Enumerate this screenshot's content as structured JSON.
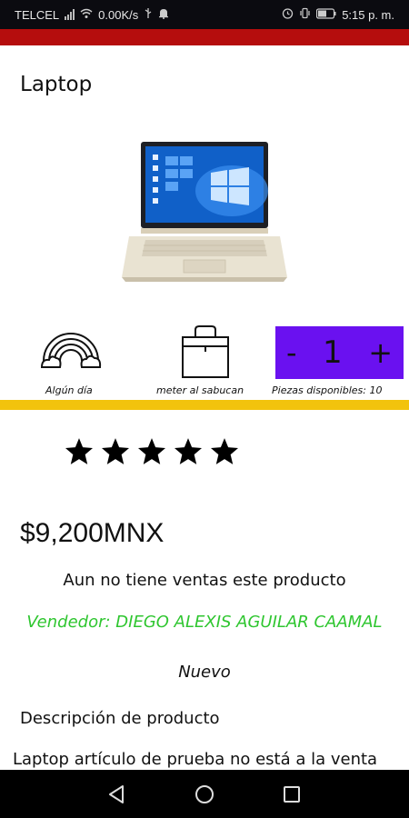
{
  "status_bar": {
    "carrier": "TELCEL",
    "speed": "0.00K/s",
    "time": "5:15 p. m.",
    "icons": [
      "signal-icon",
      "wifi-icon",
      "usb-icon",
      "notification-bell-icon",
      "alarm-icon",
      "vibrate-icon",
      "battery-icon"
    ]
  },
  "colors": {
    "header_accent": "#b50d0d",
    "quantity_bg": "#6a11f0",
    "divider": "#f2c30d",
    "seller_text": "#2fc630"
  },
  "product": {
    "title": "Laptop",
    "image": "laptop-photo",
    "features": [
      {
        "icon": "rainbow-icon",
        "caption": "Algún día"
      },
      {
        "icon": "shopping-bag-icon",
        "caption": "meter al sabucan"
      }
    ],
    "quantity": {
      "decrement_label": "-",
      "value": "1",
      "increment_label": "+",
      "available_caption": "Piezas disponibles: 10"
    },
    "rating_stars": 5,
    "price": "$9,200MNX",
    "sales_note": "Aun no tiene ventas este producto",
    "seller": "Vendedor: DIEGO ALEXIS AGUILAR CAAMAL",
    "condition": "Nuevo",
    "description_title": "Descripción de producto",
    "description": "Laptop artículo de prueba no está a la venta"
  },
  "nav_bar": {
    "buttons": [
      "back-icon",
      "home-icon",
      "recents-icon"
    ]
  }
}
